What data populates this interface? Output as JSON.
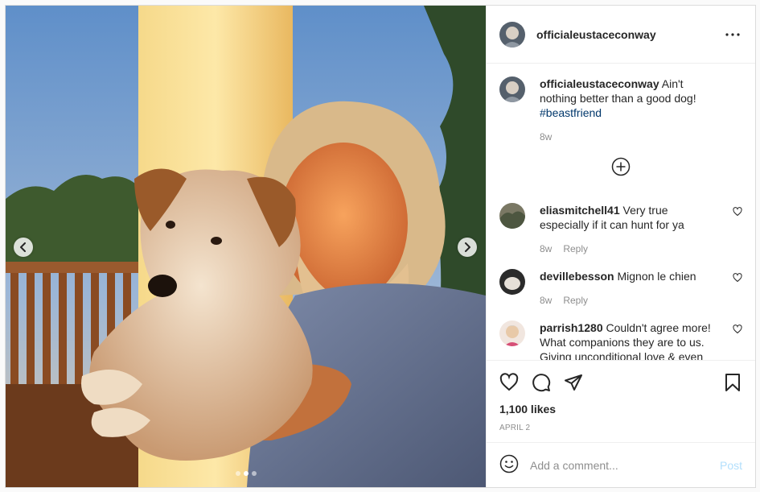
{
  "post": {
    "author": {
      "username": "officialeustaceconway"
    },
    "caption": {
      "username": "officialeustaceconway",
      "text": "Ain't nothing better than a good dog!",
      "hashtag": "#beastfriend",
      "time": "8w"
    },
    "comments": [
      {
        "username": "eliasmitchell41",
        "text": "Very true especially if it can hunt for ya",
        "time": "8w",
        "reply": "Reply"
      },
      {
        "username": "devillebesson",
        "text": "Mignon le chien",
        "time": "8w",
        "reply": "Reply"
      },
      {
        "username": "parrish1280",
        "text": "Couldn't agree more! What companions they are to us. Giving unconditional love & even"
      }
    ],
    "likes": "1,100 likes",
    "date": "APRIL 2",
    "add_comment": {
      "placeholder": "Add a comment...",
      "post_label": "Post"
    },
    "carousel": {
      "total": 3,
      "active": 2
    }
  },
  "icons": {
    "more": "more-options-icon",
    "load_more": "plus-circle-icon",
    "like": "heart-icon",
    "comment": "comment-icon",
    "share": "paper-plane-icon",
    "save": "bookmark-icon",
    "emoji": "emoji-icon",
    "prev": "chevron-left-icon",
    "next": "chevron-right-icon"
  },
  "colors": {
    "hashtag": "#00376b",
    "muted": "#8e8e8e",
    "post_button": "#b2dffc",
    "border": "#dbdbdb"
  }
}
